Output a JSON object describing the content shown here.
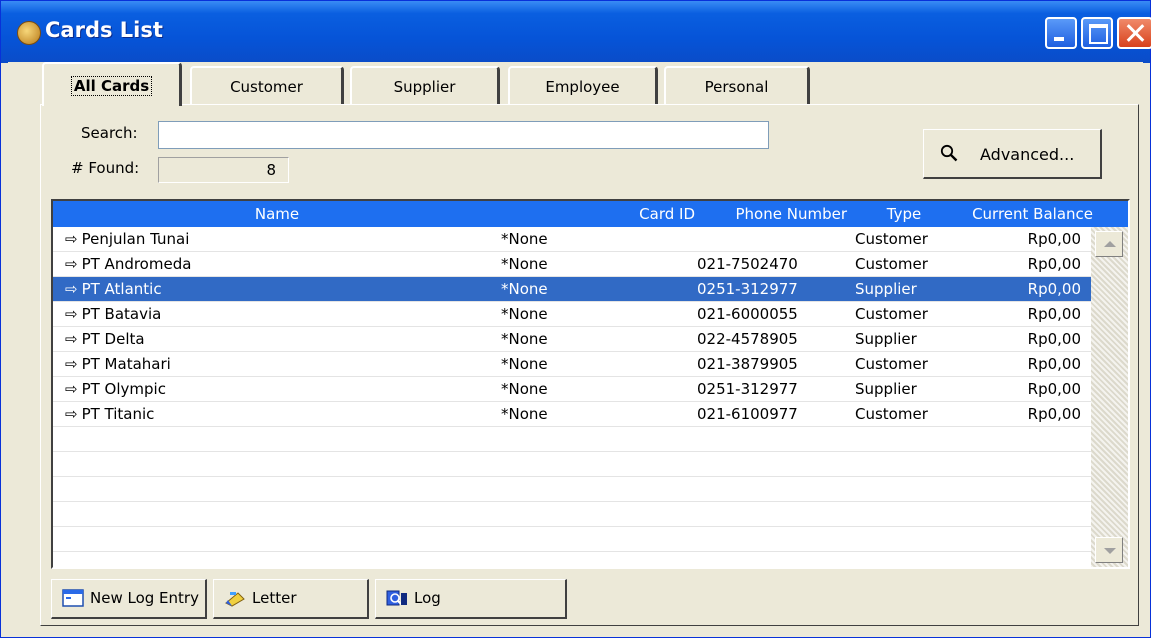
{
  "window": {
    "title": "Cards List"
  },
  "tabs": [
    {
      "label": "All Cards",
      "active": true
    },
    {
      "label": "Customer"
    },
    {
      "label": "Supplier"
    },
    {
      "label": "Employee"
    },
    {
      "label": "Personal"
    }
  ],
  "search": {
    "label": "Search:",
    "value": "",
    "found_label": "# Found:",
    "found_value": "8"
  },
  "advanced_button": {
    "label": "Advanced..."
  },
  "table": {
    "headers": {
      "name": "Name",
      "card_id": "Card ID",
      "phone": "Phone Number",
      "type": "Type",
      "balance": "Current Balance"
    },
    "rows": [
      {
        "name": "Penjulan Tunai",
        "card_id": "*None",
        "phone": "",
        "type": "Customer",
        "balance": "Rp0,00"
      },
      {
        "name": "PT Andromeda",
        "card_id": "*None",
        "phone": "021-7502470",
        "type": "Customer",
        "balance": "Rp0,00"
      },
      {
        "name": "PT Atlantic",
        "card_id": "*None",
        "phone": "0251-312977",
        "type": "Supplier",
        "balance": "Rp0,00"
      },
      {
        "name": "PT Batavia",
        "card_id": "*None",
        "phone": "021-6000055",
        "type": "Customer",
        "balance": "Rp0,00"
      },
      {
        "name": "PT Delta",
        "card_id": "*None",
        "phone": "022-4578905",
        "type": "Supplier",
        "balance": "Rp0,00"
      },
      {
        "name": "PT Matahari",
        "card_id": "*None",
        "phone": "021-3879905",
        "type": "Customer",
        "balance": "Rp0,00"
      },
      {
        "name": "PT Olympic",
        "card_id": "*None",
        "phone": "0251-312977",
        "type": "Supplier",
        "balance": "Rp0,00"
      },
      {
        "name": "PT Titanic",
        "card_id": "*None",
        "phone": "021-6100977",
        "type": "Customer",
        "balance": "Rp0,00"
      }
    ],
    "selected_index": 2,
    "row_arrow": "⇨"
  },
  "bottom_buttons": {
    "new_log_entry": "New Log Entry",
    "letter": "Letter",
    "log": "Log"
  }
}
